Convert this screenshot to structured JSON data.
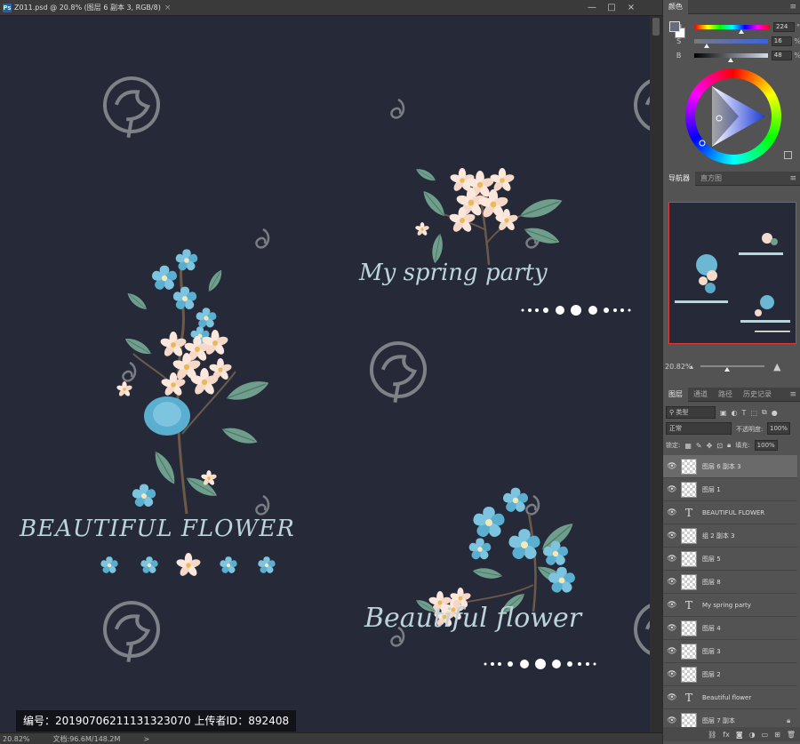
{
  "document": {
    "tab_title": "Z011.psd @ 20.8% (图层 6 副本 3, RGB/8)",
    "close": "×"
  },
  "window": {
    "minimize": "—",
    "maximize": "□",
    "close": "×"
  },
  "artwork": {
    "text_beautiful_flower_caps": "BEAUTIFUL FLOWER",
    "text_my_spring_party": "My spring party",
    "text_beautiful_flower_script": "Beautiful flower"
  },
  "watermark": {
    "caption": "编号：20190706211131323070 上传者ID：892408"
  },
  "status_bar": {
    "zoom": "20.82%",
    "doc_size": "文档:96.6M/148.2M",
    "arrow": ">"
  },
  "color_panel": {
    "tab": "颜色",
    "menu": "≡",
    "h_label": "H",
    "h_value": "224",
    "h_unit": "°",
    "h_fraction": 0.622,
    "s_label": "S",
    "s_value": "16",
    "s_unit": "%",
    "s_fraction": 0.16,
    "b_label": "B",
    "b_value": "48",
    "b_unit": "%",
    "b_fraction": 0.48,
    "foreground_color": "#676b7a",
    "background_color": "#ffffff"
  },
  "navigator_panel": {
    "tab_navigator": "导航器",
    "tab_histogram": "直方图",
    "menu": "≡",
    "zoom_value": "20.82%",
    "zoom_fraction": 0.42
  },
  "layers_panel": {
    "tabs": [
      "图层",
      "通道",
      "路径",
      "历史记录"
    ],
    "menu": "≡",
    "filter_kind": "类型",
    "blend_mode": "正常",
    "opacity_label": "不透明度:",
    "opacity_value": "100%",
    "lock_label": "锁定:",
    "fill_label": "填充:",
    "fill_value": "100%",
    "layers": [
      {
        "name": "图层 6 副本 3",
        "type": "pixel",
        "selected": true
      },
      {
        "name": "图层 1",
        "type": "pixel",
        "selected": false
      },
      {
        "name": "BEAUTIFUL FLOWER",
        "type": "text",
        "selected": false
      },
      {
        "name": "组 2 副本 3",
        "type": "pixel",
        "selected": false
      },
      {
        "name": "图层 5",
        "type": "pixel",
        "selected": false
      },
      {
        "name": "图层 8",
        "type": "pixel",
        "selected": false
      },
      {
        "name": "My spring party",
        "type": "text",
        "selected": false
      },
      {
        "name": "图层 4",
        "type": "pixel",
        "selected": false
      },
      {
        "name": "图层 3",
        "type": "pixel",
        "selected": false
      },
      {
        "name": "图层 2",
        "type": "pixel",
        "selected": false
      },
      {
        "name": "Beautiful flower",
        "type": "text",
        "selected": false
      },
      {
        "name": "图层 7 副本",
        "type": "pixel",
        "selected": false,
        "locked": true
      }
    ]
  }
}
